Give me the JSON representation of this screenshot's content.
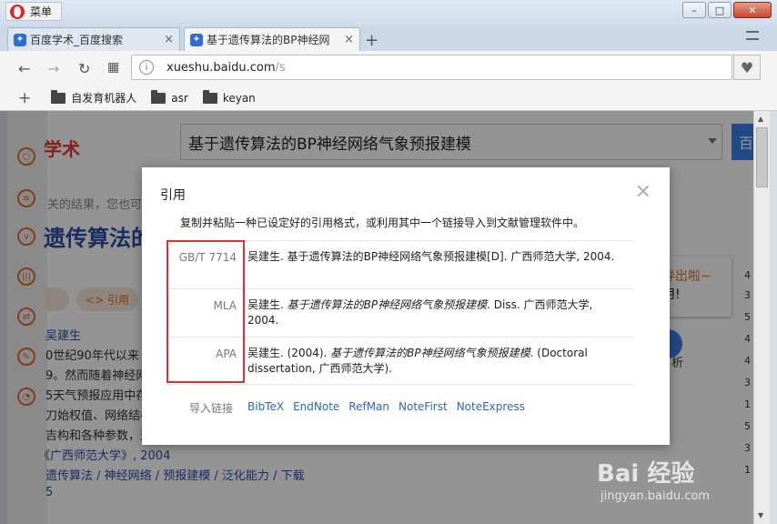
{
  "browser": {
    "menu_label": "菜单",
    "tabs": [
      {
        "title": "百度学术_百度搜索",
        "active": false
      },
      {
        "title": "基于遗传算法的BP神经网",
        "active": true
      }
    ],
    "new_tab": "+",
    "url_host": "xueshu.baidu.com",
    "url_path": "/s",
    "bookmarks": [
      {
        "label": "自发育机器人"
      },
      {
        "label": "asr"
      },
      {
        "label": "keyan"
      }
    ]
  },
  "background_page": {
    "logo_text": "学术",
    "search_query": "基于遗传算法的BP神经网络气象预报建模",
    "search_button": "百",
    "result_hint": "关的结果，您也可以",
    "title_fragment": "遗传算法的",
    "cite_label": "<> 引用",
    "author": "吴建生",
    "lines": [
      "0世纪90年代以来",
      "9。然而随着神经网",
      "5天气预报应用中存",
      "刀始权值、网络结构",
      "吉构和各种参数，达",
      "《广西师范大学》, 2004",
      "遗传算法 / 神经网络 / 预报建模 / 泛化能力 / 下载",
      "5"
    ],
    "promo_line1": "导出啦~",
    "promo_line2": "用!",
    "right_numbers": [
      "4",
      "3",
      "5",
      "4",
      "4",
      "3",
      "1",
      "5",
      "3",
      "1"
    ],
    "side_fragment": "析"
  },
  "citation_dialog": {
    "title": "引用",
    "close": "×",
    "description": "复制并粘贴一种已设定好的引用格式，或利用其中一个链接导入到文献管理软件中。",
    "formats": [
      {
        "name": "GB/T 7714",
        "pre": "吴建生. 基于遗传算法的BP神经网络气象预报建模[D]. 广西师范大学, 2004.",
        "italic": "",
        "post": ""
      },
      {
        "name": "MLA",
        "pre": "吴建生. ",
        "italic": "基于遗传算法的BP神经网络气象预报建模",
        "post": ". Diss. 广西师范大学, 2004."
      },
      {
        "name": "APA",
        "pre": "吴建生. (2004). ",
        "italic": "基于遗传算法的BP神经网络气象预报建模",
        "post": ". (Doctoral dissertation, 广西师范大学)."
      }
    ],
    "import_label": "导入链接",
    "import_links": [
      "BibTeX",
      "EndNote",
      "RefMan",
      "NoteFirst",
      "NoteExpress"
    ]
  },
  "watermark": {
    "main": "Bai  经验",
    "sub": "jingyan.baidu.com"
  },
  "colors": {
    "highlight_box": "#e2302d",
    "link": "#2d65c4",
    "accent": "#e06b2f"
  }
}
